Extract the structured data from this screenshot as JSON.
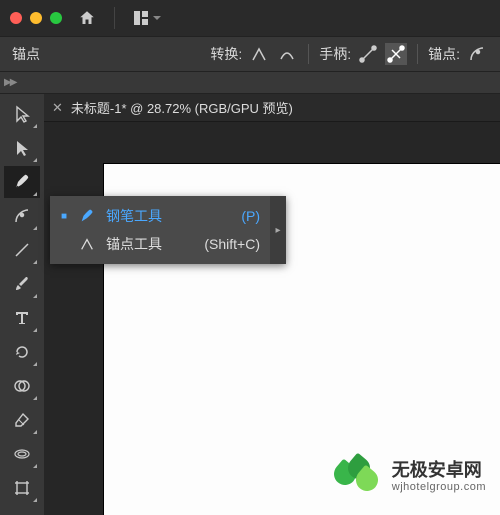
{
  "titlebar": {},
  "controlbar": {
    "anchor_label": "锚点",
    "convert_label": "转换:",
    "handle_label": "手柄:",
    "anchor2_label": "锚点:"
  },
  "tab": {
    "title": "未标题-1* @ 28.72% (RGB/GPU 预览)"
  },
  "flyout": {
    "items": [
      {
        "label": "钢笔工具",
        "shortcut": "(P)",
        "selected": true,
        "icon": "pen"
      },
      {
        "label": "锚点工具",
        "shortcut": "(Shift+C)",
        "selected": false,
        "icon": "anchor"
      }
    ]
  },
  "tools": [
    {
      "name": "selection",
      "active": false
    },
    {
      "name": "direct-selection",
      "active": false
    },
    {
      "name": "pen",
      "active": true
    },
    {
      "name": "curvature",
      "active": false
    },
    {
      "name": "line",
      "active": false
    },
    {
      "name": "brush",
      "active": false
    },
    {
      "name": "type",
      "active": false
    },
    {
      "name": "rotate",
      "active": false
    },
    {
      "name": "shape-builder",
      "active": false
    },
    {
      "name": "eraser",
      "active": false
    },
    {
      "name": "blend",
      "active": false
    },
    {
      "name": "artboard",
      "active": false
    }
  ],
  "watermark": {
    "title": "无极安卓网",
    "subtitle": "wjhotelgroup.com"
  }
}
